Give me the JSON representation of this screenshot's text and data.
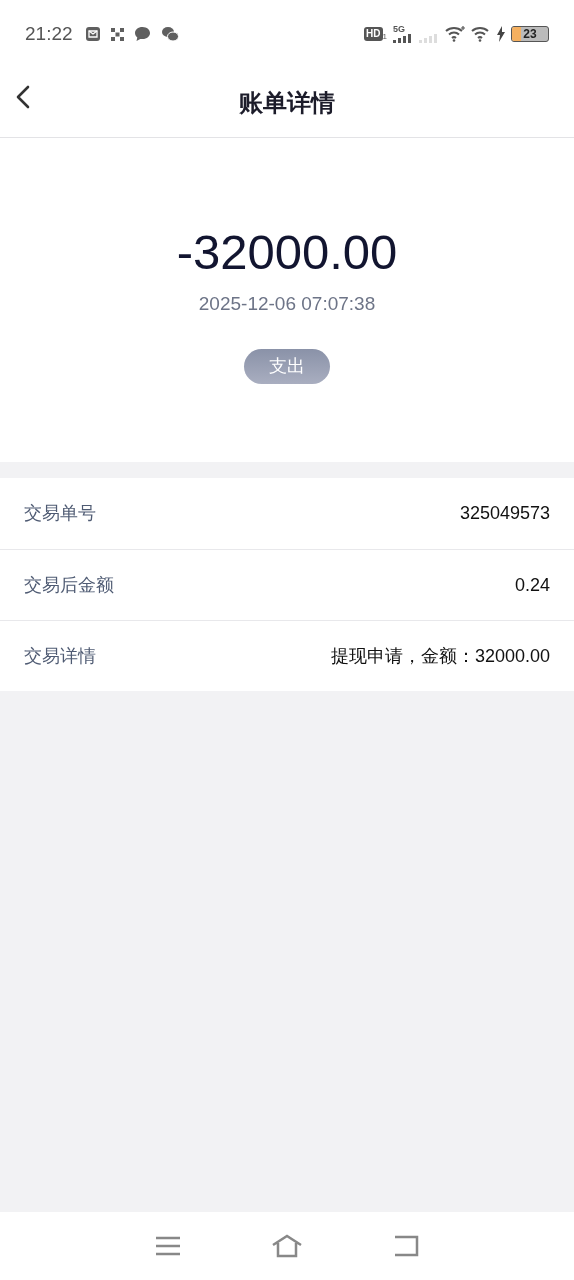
{
  "status_bar": {
    "time": "21:22",
    "hd_label": "HD",
    "sim_slot": "1",
    "network": "5G",
    "battery": "23"
  },
  "header": {
    "title": "账单详情"
  },
  "summary": {
    "amount": "-32000.00",
    "time": "2025-12-06 07:07:38",
    "tag": "支出"
  },
  "details": [
    {
      "label": "交易单号",
      "value": "325049573"
    },
    {
      "label": "交易后金额",
      "value": "0.24"
    },
    {
      "label": "交易详情",
      "value": "提现申请，金额：32000.00"
    }
  ]
}
